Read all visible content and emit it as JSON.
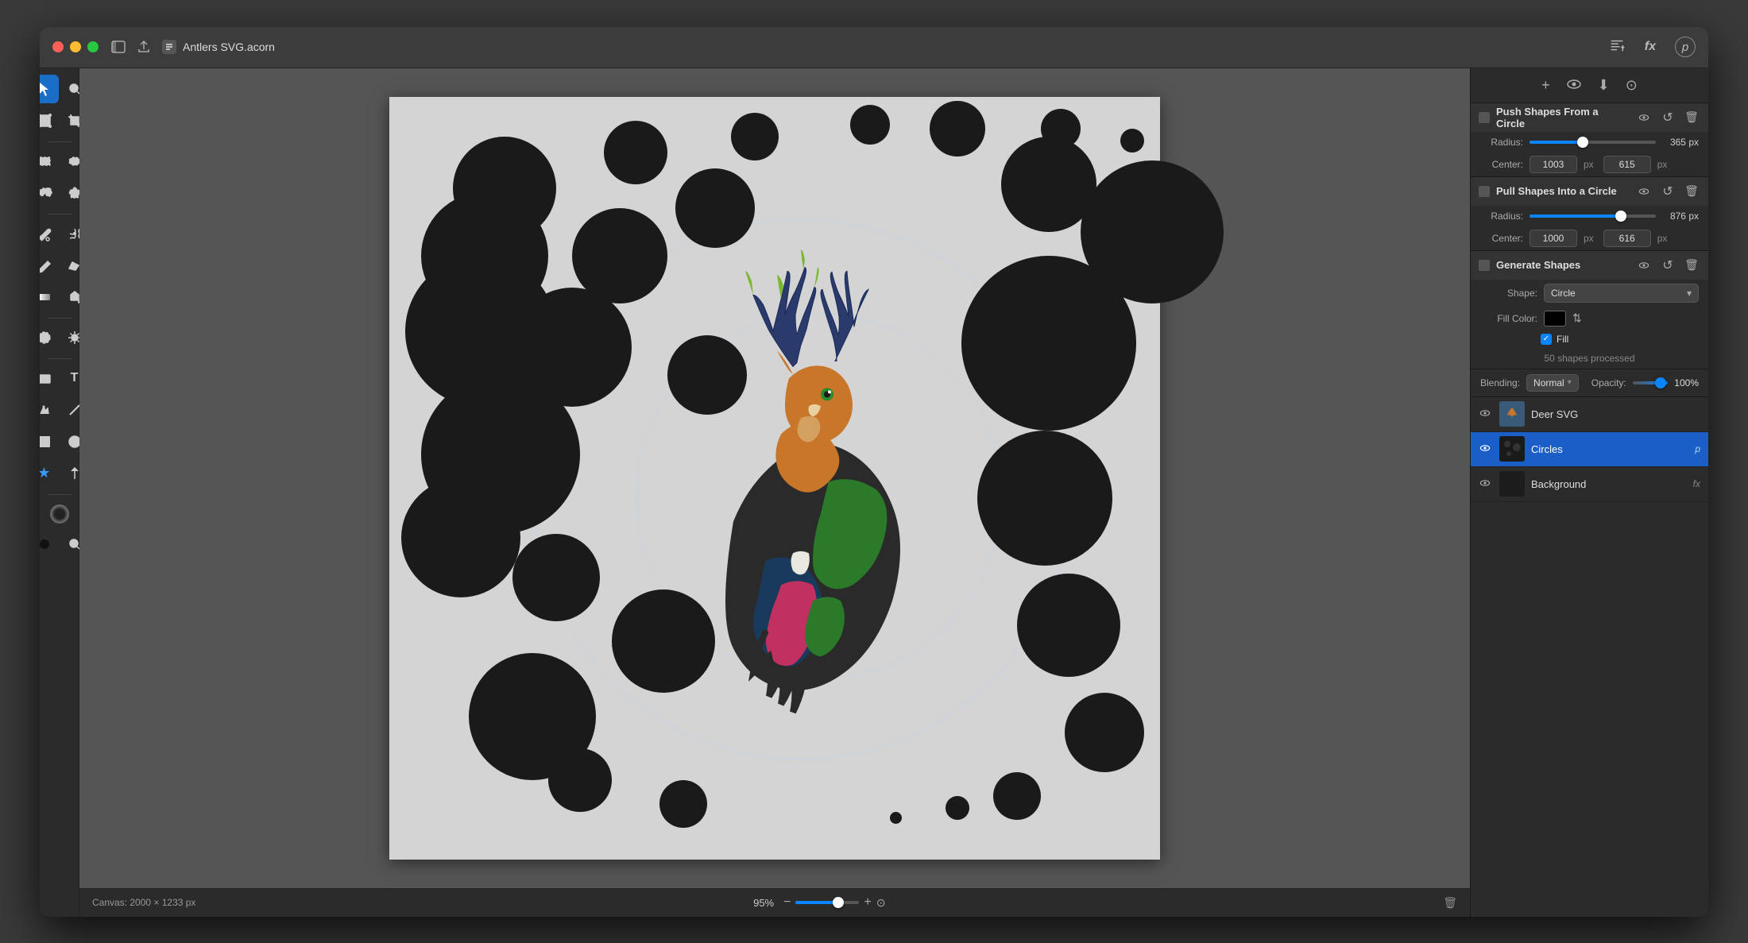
{
  "window": {
    "title": "Antlers SVG.acorn",
    "traffic_lights": [
      "red",
      "yellow",
      "green"
    ]
  },
  "titlebar": {
    "filename": "Antlers SVG.acorn",
    "right_icons": [
      "text-tool-icon",
      "fx-icon",
      "p-icon"
    ]
  },
  "toolbar": {
    "tools": [
      {
        "name": "select",
        "label": "▶",
        "active": true
      },
      {
        "name": "zoom",
        "label": "⊕"
      },
      {
        "name": "transform",
        "label": "⤡"
      },
      {
        "name": "crop",
        "label": "✂"
      },
      {
        "name": "rect-select",
        "label": "▭"
      },
      {
        "name": "ellipse-select",
        "label": "◯"
      },
      {
        "name": "lasso-select",
        "label": "⌒"
      },
      {
        "name": "poly-select",
        "label": "⬡"
      },
      {
        "name": "brush",
        "label": "✏"
      },
      {
        "name": "magic-wand",
        "label": "✦"
      },
      {
        "name": "pencil",
        "label": "✒"
      },
      {
        "name": "eraser",
        "label": "◻"
      },
      {
        "name": "gradient",
        "label": "▦"
      },
      {
        "name": "paint-bucket",
        "label": "⬧"
      },
      {
        "name": "eyedropper",
        "label": "💧"
      },
      {
        "name": "color-picker",
        "label": "⊙"
      },
      {
        "name": "blur",
        "label": "☁"
      },
      {
        "name": "sharpen",
        "label": "☀"
      },
      {
        "name": "rect-shape",
        "label": "▬"
      },
      {
        "name": "text",
        "label": "T"
      },
      {
        "name": "pen",
        "label": "✒"
      },
      {
        "name": "line",
        "label": "/"
      },
      {
        "name": "shape",
        "label": "◼"
      },
      {
        "name": "ellipse",
        "label": "●"
      },
      {
        "name": "star",
        "label": "★"
      },
      {
        "name": "arrow",
        "label": "↑"
      },
      {
        "name": "circle-tool",
        "label": "◉"
      },
      {
        "name": "color-adjust",
        "label": "⊱"
      },
      {
        "name": "magnify",
        "label": "🔍"
      }
    ]
  },
  "canvas": {
    "size_label": "Canvas: 2000 × 1233 px",
    "zoom": "95%"
  },
  "right_panel": {
    "top_icons": [
      "+",
      "👁",
      "⬇",
      "⊙"
    ],
    "filters": [
      {
        "title": "Push Shapes From a Circle",
        "radius_label": "Radius:",
        "radius_value": "365",
        "radius_unit": "px",
        "radius_pct": 40,
        "center_label": "Center:",
        "center_x": "1003",
        "center_y": "615",
        "center_unit": "px"
      },
      {
        "title": "Pull Shapes Into a Circle",
        "radius_label": "Radius:",
        "radius_value": "876",
        "radius_unit": "px",
        "radius_pct": 70,
        "center_label": "Center:",
        "center_x": "1000",
        "center_y": "616",
        "center_unit": "px"
      }
    ],
    "generate": {
      "title": "Generate Shapes",
      "shape_label": "Shape:",
      "shape_value": "Circle",
      "fill_color_label": "Fill Color:",
      "fill_checked": true,
      "fill_label": "Fill",
      "processed_text": "50 shapes processed"
    },
    "blending": {
      "label": "Blending:",
      "mode": "Normal",
      "opacity_label": "Opacity:",
      "opacity_value": "100%"
    },
    "layers": [
      {
        "name": "Deer SVG",
        "type": "deer",
        "badge": "",
        "active": false,
        "visible": true
      },
      {
        "name": "Circles",
        "type": "circles",
        "badge": "p",
        "active": true,
        "visible": true
      },
      {
        "name": "Background",
        "type": "bg",
        "badge": "fx",
        "active": false,
        "visible": true
      }
    ]
  }
}
